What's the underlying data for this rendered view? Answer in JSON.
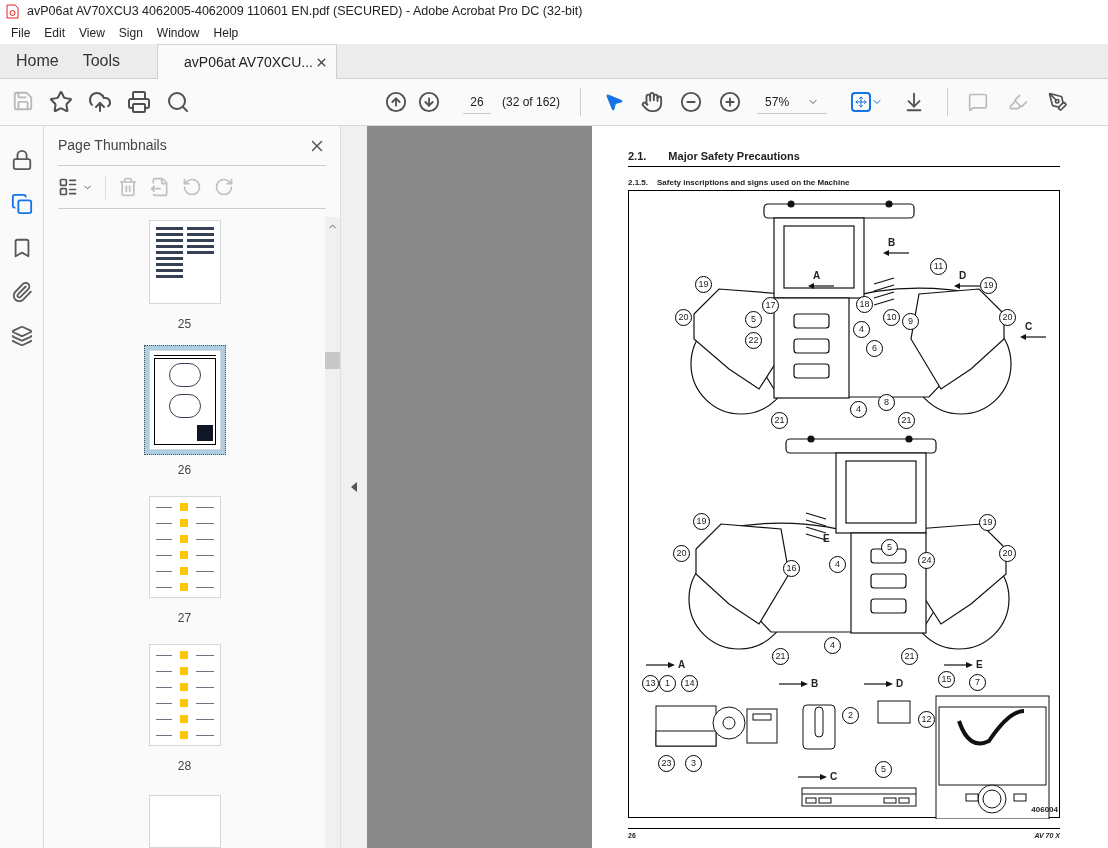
{
  "window": {
    "title": "avP06at AV70XCU3 4062005-4062009 110601 EN.pdf (SECURED) - Adobe Acrobat Pro DC (32-bit)"
  },
  "menu": [
    "File",
    "Edit",
    "View",
    "Sign",
    "Window",
    "Help"
  ],
  "tabs": [
    {
      "label": "Home",
      "selected": false,
      "kind": "nav"
    },
    {
      "label": "Tools",
      "selected": false,
      "kind": "nav"
    },
    {
      "label": "avP06at AV70XCU...",
      "selected": true,
      "kind": "document"
    }
  ],
  "toolbar": {
    "page_number": "26",
    "page_count": "(32 of 162)",
    "zoom": "57%",
    "save_disabled": true
  },
  "navigation_pane_buttons": [
    {
      "selected": false
    },
    {
      "selected": true
    },
    {
      "selected": false
    },
    {
      "selected": false
    },
    {
      "selected": false
    }
  ],
  "thumbnails_panel": {
    "title": "Page Thumbnails",
    "thumbnails": [
      {
        "label": "25",
        "selected": false,
        "kind": "text"
      },
      {
        "label": "26",
        "selected": true,
        "kind": "figure"
      },
      {
        "label": "27",
        "selected": false,
        "kind": "table"
      },
      {
        "label": "28",
        "selected": false,
        "kind": "table"
      }
    ]
  },
  "page": {
    "heading": {
      "number": "2.1.",
      "title": "Major Safety Precautions"
    },
    "subheading": {
      "number": "2.1.5.",
      "title": "Safety inscriptions and signs used on the Machine"
    },
    "figure": {
      "callouts": [
        "19",
        "20",
        "5",
        "17",
        "22",
        "18",
        "4",
        "11",
        "10",
        "9",
        "6",
        "19",
        "20",
        "4",
        "8",
        "21",
        "21",
        "19",
        "20",
        "16",
        "5",
        "4",
        "24",
        "19",
        "20",
        "4",
        "21",
        "21",
        "13",
        "1",
        "14",
        "23",
        "3",
        "2",
        "12",
        "5",
        "15",
        "7"
      ],
      "view_labels": [
        "A",
        "B",
        "D",
        "C",
        "E",
        "A",
        "B",
        "D",
        "C",
        "E"
      ],
      "figure_number": "406004"
    },
    "footer": {
      "page": "26",
      "model": "AV 70 X"
    }
  }
}
